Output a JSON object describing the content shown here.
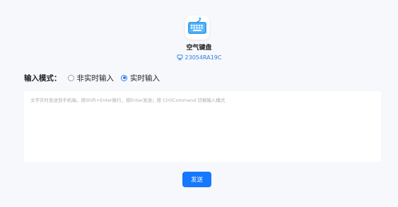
{
  "app": {
    "name": "空气键盘",
    "icon": "keyboard-icon",
    "accent_color": "#1677ff"
  },
  "device": {
    "icon": "computer-icon",
    "name": "23054RA19C"
  },
  "input_mode": {
    "label": "输入模式：",
    "options": [
      {
        "label": "非实时输入",
        "checked": false
      },
      {
        "label": "实时输入",
        "checked": true
      }
    ]
  },
  "text_input": {
    "value": "",
    "placeholder": "文字实时发送到手机端，按Shift+Enter换行，按Enter发送；按 Ctrl/Command 切换输入模式"
  },
  "send_button": {
    "label": "发送"
  }
}
